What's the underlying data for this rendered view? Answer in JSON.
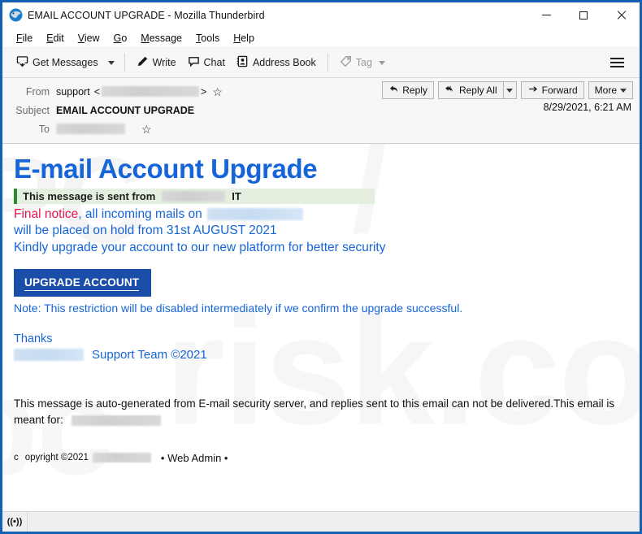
{
  "window": {
    "title": "EMAIL ACCOUNT UPGRADE - Mozilla Thunderbird",
    "app_icon": "thunderbird-icon",
    "controls": {
      "minimize": "minimize-icon",
      "maximize": "maximize-icon",
      "close": "close-icon"
    }
  },
  "menubar": {
    "items": [
      {
        "label": "File",
        "accesskey": "F"
      },
      {
        "label": "Edit",
        "accesskey": "E"
      },
      {
        "label": "View",
        "accesskey": "V"
      },
      {
        "label": "Go",
        "accesskey": "G"
      },
      {
        "label": "Message",
        "accesskey": "M"
      },
      {
        "label": "Tools",
        "accesskey": "T"
      },
      {
        "label": "Help",
        "accesskey": "H"
      }
    ]
  },
  "toolbar": {
    "get_messages": "Get Messages",
    "write": "Write",
    "chat": "Chat",
    "address_book": "Address Book",
    "tag": "Tag",
    "tag_disabled": true,
    "app_menu": "app-menu-icon"
  },
  "message_header": {
    "from_label": "From",
    "from_value": "support",
    "from_bracket_open": "<",
    "from_bracket_close": ">",
    "from_address_redacted": true,
    "subject_label": "Subject",
    "subject_value": "EMAIL ACCOUNT UPGRADE",
    "to_label": "To",
    "to_value_redacted": true,
    "date": "8/29/2021, 6:21 AM",
    "actions": {
      "reply": "Reply",
      "reply_all": "Reply All",
      "forward": "Forward",
      "more": "More"
    }
  },
  "message_body": {
    "heading": "E-mail Account Upgrade",
    "banner": {
      "text_before": "This message is sent from",
      "redacted": true,
      "text_after": "IT",
      "bg_color": "#e4efe0",
      "accent_color": "#2c8c2c"
    },
    "line1_accent": "Final notice",
    "line1_rest": ", all incoming mails on",
    "line2": "will be placed on hold  from 31st AUGUST 2021",
    "line3": "Kindly upgrade your account to our new platform for better security",
    "cta_label": "UPGRADE ACCOUNT",
    "cta_color": "#1B4EA8",
    "note": "Note: This restriction will be disabled intermediately if we confirm the upgrade successful.",
    "thanks": "Thanks",
    "signature": "Support Team ©2021",
    "disclaimer_part1": " This message is auto-generated from E-mail security server, and replies sent to this email can not be delivered.This email is meant for:",
    "copyright_prefix": "c",
    "copyright_text": "opyright ©2021",
    "copyright_suffix": "• Web Admin •",
    "link_color": "#1565D8",
    "accent_color": "#E3164F"
  },
  "statusbar": {
    "connection_icon": "((•))"
  },
  "watermark": {
    "text": "pcrisk.com"
  }
}
